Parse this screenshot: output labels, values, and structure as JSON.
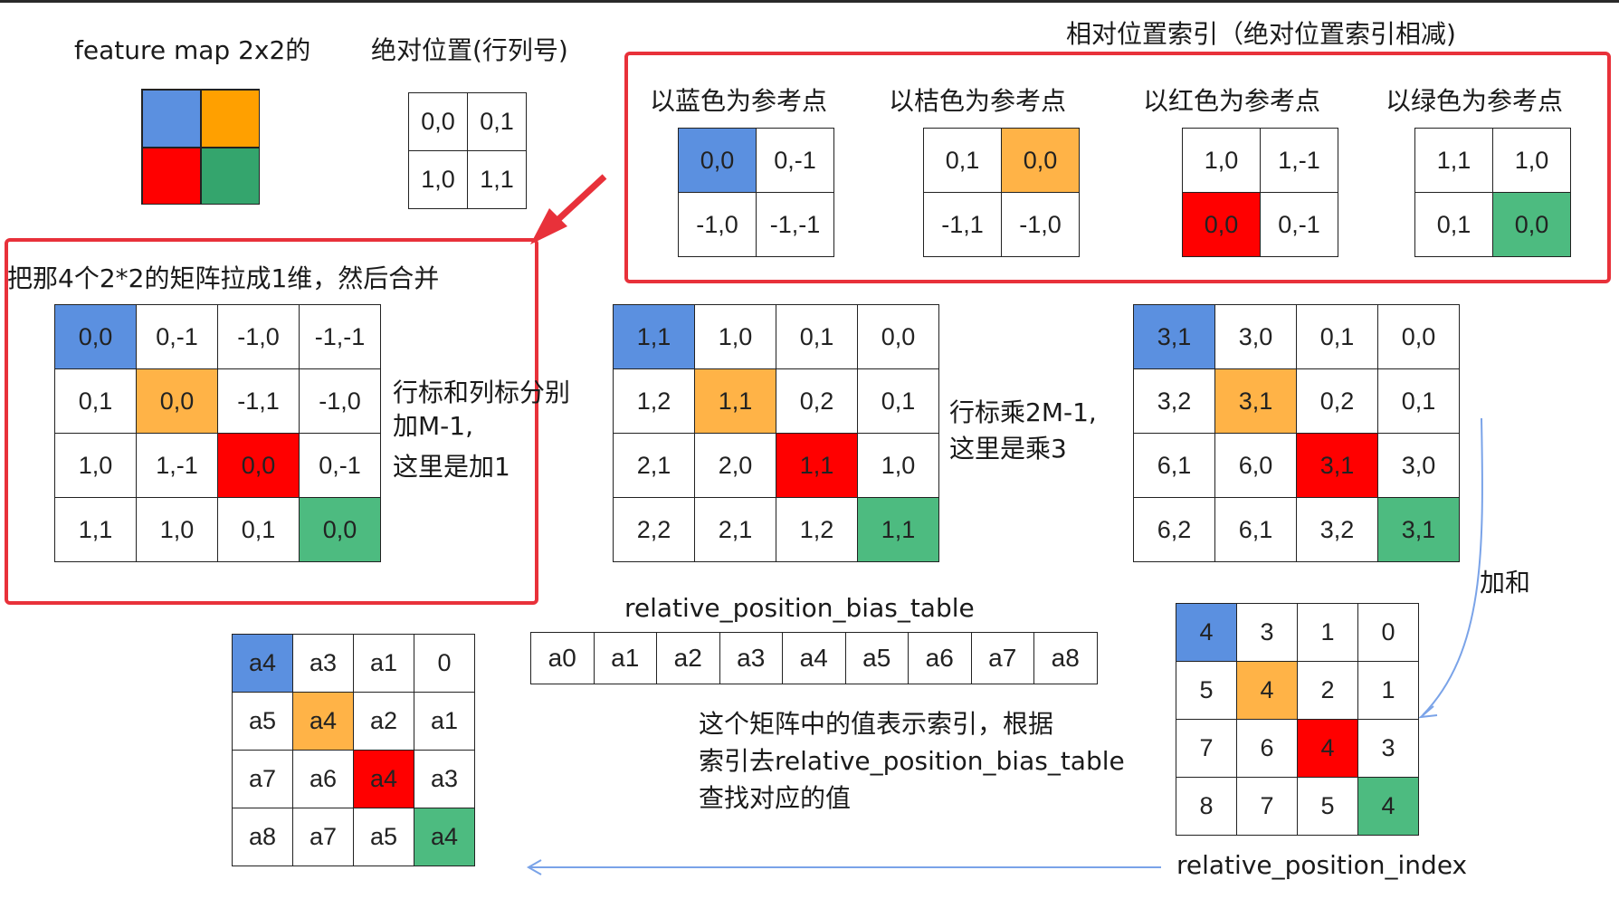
{
  "colors": {
    "blue": "#5b90e0",
    "orange": "#ffa000",
    "red": "#ff0000",
    "green": "#34a56d",
    "frame": "#e8313a",
    "arrow": "#7aa3e8"
  },
  "labels": {
    "feature_map": "feature map 2x2的",
    "abs_pos": "绝对位置(行列号)",
    "rel_index_title": "相对位置索引（绝对位置索引相减)",
    "ref_blue": "以蓝色为参考点",
    "ref_orange": "以桔色为参考点",
    "ref_red": "以红色为参考点",
    "ref_green": "以绿色为参考点",
    "flatten": "把那4个2*2的矩阵拉成1维，然后合并",
    "add_m1_l1": "行标和列标分别",
    "add_m1_l2": "加M-1,",
    "add_m1_l3": "这里是加1",
    "mul_l1": "行标乘2M-1,",
    "mul_l2": "这里是乘3",
    "sum": "加和",
    "bias_table_title": "relative_position_bias_table",
    "explain_l1": "这个矩阵中的值表示索引，根据",
    "explain_l2": "索引去relative_position_bias_table",
    "explain_l3": "查找对应的值",
    "rel_pos_index": "relative_position_index"
  },
  "abs_grid": [
    [
      "0,0",
      "0,1"
    ],
    [
      "1,0",
      "1,1"
    ]
  ],
  "ref_grids": {
    "blue": [
      [
        "0,0",
        "0,-1"
      ],
      [
        "-1,0",
        "-1,-1"
      ]
    ],
    "orange": [
      [
        "0,1",
        "0,0"
      ],
      [
        "-1,1",
        "-1,0"
      ]
    ],
    "red": [
      [
        "1,0",
        "1,-1"
      ],
      [
        "0,0",
        "0,-1"
      ]
    ],
    "green": [
      [
        "1,1",
        "1,0"
      ],
      [
        "0,1",
        "0,0"
      ]
    ]
  },
  "flat_matrix": [
    [
      "0,0",
      "0,-1",
      "-1,0",
      "-1,-1"
    ],
    [
      "0,1",
      "0,0",
      "-1,1",
      "-1,0"
    ],
    [
      "1,0",
      "1,-1",
      "0,0",
      "0,-1"
    ],
    [
      "1,1",
      "1,0",
      "0,1",
      "0,0"
    ]
  ],
  "plus_matrix": [
    [
      "1,1",
      "1,0",
      "0,1",
      "0,0"
    ],
    [
      "1,2",
      "1,1",
      "0,2",
      "0,1"
    ],
    [
      "2,1",
      "2,0",
      "1,1",
      "1,0"
    ],
    [
      "2,2",
      "2,1",
      "1,2",
      "1,1"
    ]
  ],
  "mul_matrix": [
    [
      "3,1",
      "3,0",
      "0,1",
      "0,0"
    ],
    [
      "3,2",
      "3,1",
      "0,2",
      "0,1"
    ],
    [
      "6,1",
      "6,0",
      "3,1",
      "3,0"
    ],
    [
      "6,2",
      "6,1",
      "3,2",
      "3,1"
    ]
  ],
  "index_matrix": [
    [
      "4",
      "3",
      "1",
      "0"
    ],
    [
      "5",
      "4",
      "2",
      "1"
    ],
    [
      "7",
      "6",
      "4",
      "3"
    ],
    [
      "8",
      "7",
      "5",
      "4"
    ]
  ],
  "bias_table": [
    "a0",
    "a1",
    "a2",
    "a3",
    "a4",
    "a5",
    "a6",
    "a7",
    "a8"
  ],
  "bias_matrix": [
    [
      "a4",
      "a3",
      "a1",
      "0"
    ],
    [
      "a5",
      "a4",
      "a2",
      "a1"
    ],
    [
      "a7",
      "a6",
      "a4",
      "a3"
    ],
    [
      "a8",
      "a7",
      "a5",
      "a4"
    ]
  ]
}
